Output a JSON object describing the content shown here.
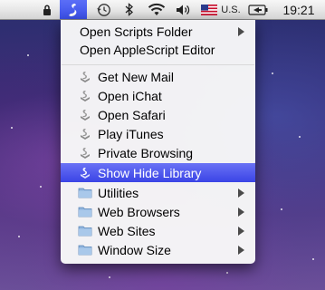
{
  "menubar": {
    "language": "U.S.",
    "clock": "19:21"
  },
  "menu": {
    "groups": [
      {
        "items": [
          {
            "label": "Open Scripts Folder",
            "submenu": true
          },
          {
            "label": "Open AppleScript Editor",
            "submenu": false
          }
        ]
      },
      {
        "items": [
          {
            "label": "Get New Mail",
            "icon": "script-icon"
          },
          {
            "label": "Open iChat",
            "icon": "script-icon"
          },
          {
            "label": "Open Safari",
            "icon": "script-icon"
          },
          {
            "label": "Play iTunes",
            "icon": "script-icon"
          },
          {
            "label": "Private Browsing",
            "icon": "script-icon"
          },
          {
            "label": "Show Hide Library",
            "icon": "script-icon",
            "selected": true
          },
          {
            "label": "Utilities",
            "icon": "folder-icon",
            "submenu": true
          },
          {
            "label": "Web Browsers",
            "icon": "folder-icon",
            "submenu": true
          },
          {
            "label": "Web Sites",
            "icon": "folder-icon",
            "submenu": true
          },
          {
            "label": "Window Size",
            "icon": "folder-icon",
            "submenu": true
          }
        ]
      }
    ]
  },
  "colors": {
    "highlight": "#3a44e6",
    "menu_bg": "#f8f8f8"
  }
}
